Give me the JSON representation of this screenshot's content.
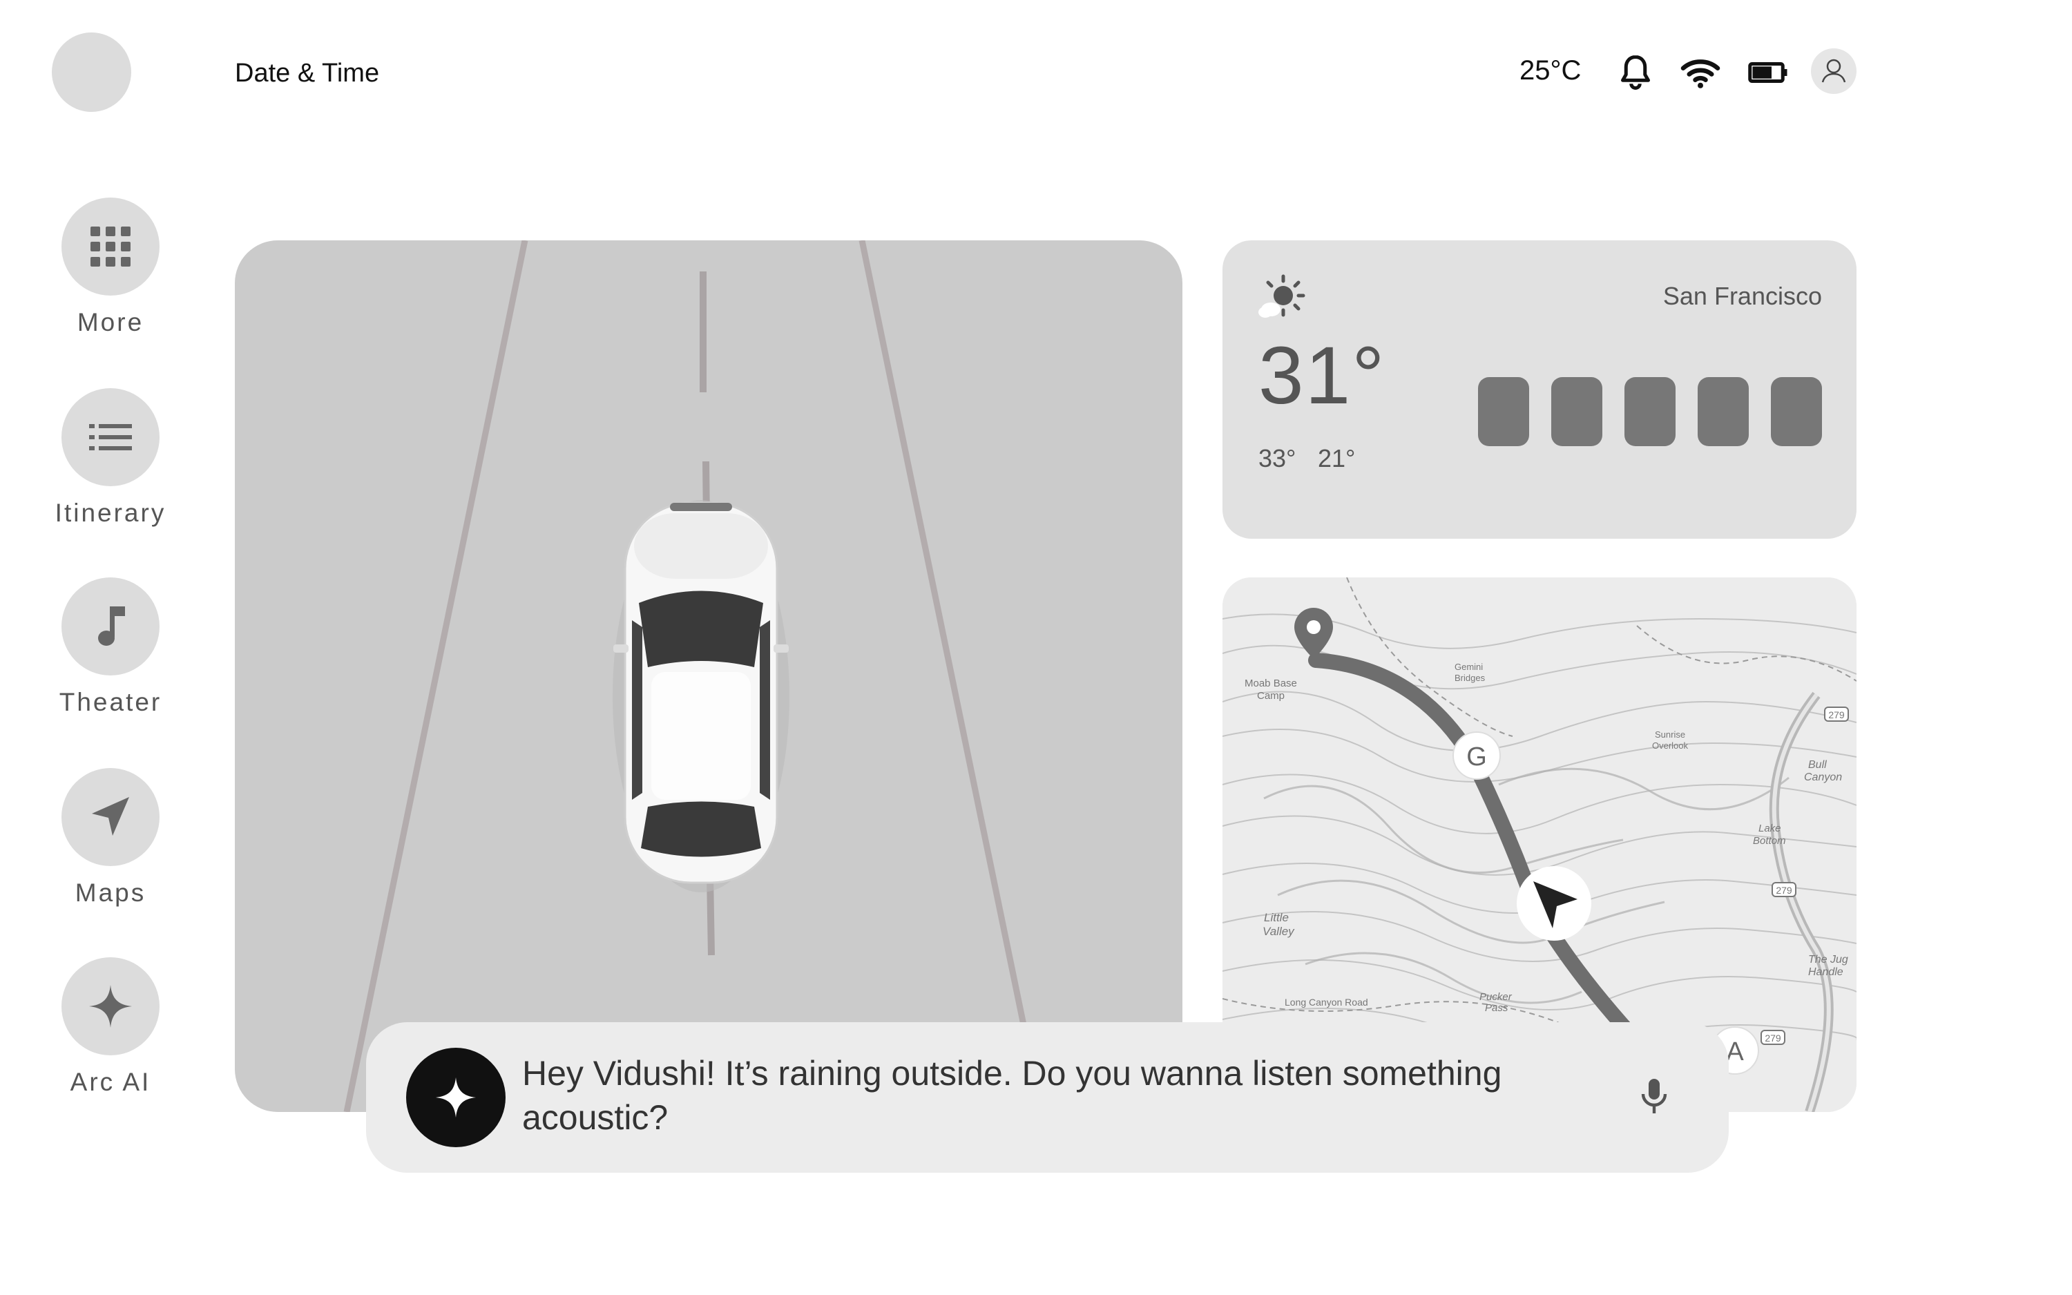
{
  "header": {
    "datetime_label": "Date & Time",
    "temperature": "25°C",
    "icons": [
      "bell-icon",
      "wifi-icon",
      "battery-icon",
      "profile-icon"
    ]
  },
  "nav": {
    "items": [
      {
        "label": "More",
        "icon": "grid-icon"
      },
      {
        "label": "Itinerary",
        "icon": "list-icon"
      },
      {
        "label": "Theater",
        "icon": "music-note-icon"
      },
      {
        "label": "Maps",
        "icon": "navigation-arrow-icon"
      },
      {
        "label": "Arc AI",
        "icon": "sparkle-icon"
      }
    ]
  },
  "weather": {
    "city": "San Francisco",
    "temp": "31°",
    "high": "33°",
    "low": "21°",
    "icon": "partly-sunny-icon"
  },
  "map": {
    "labels": {
      "moab": "Moab Base",
      "moab2": "Camp",
      "gemini": "Gemini",
      "gemini2": "Bridges",
      "sunrise": "Sunrise",
      "sunrise2": "Overlook",
      "bull": "Bull",
      "bull2": "Canyon",
      "lake": "Lake",
      "lake2": "Bottom",
      "little": "Little",
      "little2": "Valley",
      "jug": "The Jug",
      "jug2": "Handle",
      "longcanyon": "Long Canyon Road",
      "pucker": "Pucker",
      "pucker2": "Pass",
      "route279a": "279",
      "route279b": "279",
      "route279c": "279",
      "marker_g": "G",
      "marker_a": "A"
    }
  },
  "assistant": {
    "message": "Hey Vidushi! It’s raining outside. Do you wanna listen something acoustic?"
  },
  "colors": {
    "card": "#cbcbcb",
    "weather_card": "#e1e1e1",
    "forecast_bar": "#777777",
    "route": "#6e6e6e",
    "assistant_bg": "#ececec"
  }
}
